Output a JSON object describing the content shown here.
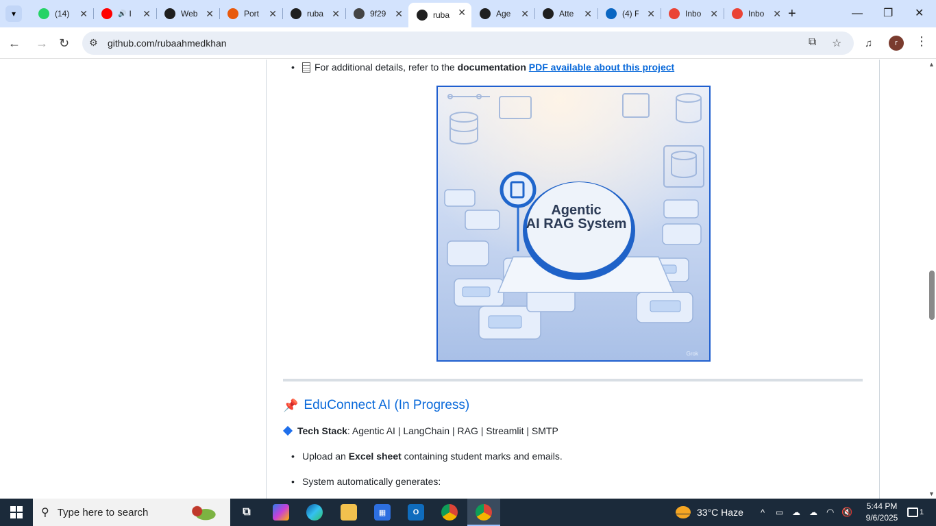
{
  "browser": {
    "tabs": [
      {
        "title": "(14)",
        "icon": "whatsapp-icon",
        "color": "#25d366"
      },
      {
        "title": "I",
        "icon": "youtube-icon",
        "color": "#ff0000",
        "audio": true
      },
      {
        "title": "Web",
        "icon": "openai-icon",
        "color": "#1f1f1f"
      },
      {
        "title": "Port",
        "icon": "portfolio-icon",
        "color": "#e8590c"
      },
      {
        "title": "ruba",
        "icon": "github-icon",
        "color": "#1f1f1f"
      },
      {
        "title": "9f29",
        "icon": "globe-icon",
        "color": "#444444"
      },
      {
        "title": "ruba",
        "icon": "github-icon",
        "color": "#1f1f1f",
        "active": true
      },
      {
        "title": "Age",
        "icon": "github-icon",
        "color": "#1f1f1f"
      },
      {
        "title": "Atte",
        "icon": "github-icon",
        "color": "#1f1f1f"
      },
      {
        "title": "(4) F",
        "icon": "linkedin-icon",
        "color": "#0a66c2"
      },
      {
        "title": "Inbo",
        "icon": "gmail-icon",
        "color": "#ea4335"
      },
      {
        "title": "Inbo",
        "icon": "gmail-icon",
        "color": "#ea4335"
      }
    ],
    "url": "github.com/rubaahmedkhan",
    "avatar_letter": "r"
  },
  "readme": {
    "doc_line": {
      "prefix": "For additional details, refer to the ",
      "bold": "documentation",
      "link": "PDF available about this project"
    },
    "image": {
      "title_line1": "Agentic",
      "title_line2": "AI RAG System",
      "watermark": "Grok"
    },
    "section_title": "EduConnect AI (In Progress)",
    "tech_stack": {
      "label": "Tech Stack",
      "value": ": Agentic AI | LangChain | RAG | Streamlit | SMTP"
    },
    "bullets": [
      {
        "pre": "Upload an ",
        "bold": "Excel sheet",
        "post": " containing student marks and emails."
      },
      {
        "pre": "System automatically generates:",
        "bold": "",
        "post": ""
      }
    ]
  },
  "taskbar": {
    "search_placeholder": "Type here to search",
    "weather": "33°C  Haze",
    "time": "5:44 PM",
    "date": "9/6/2025",
    "notification_count": "1"
  },
  "colors": {
    "tabstrip": "#d3e3fd",
    "link": "#0969da",
    "taskbar": "#1b2a3a"
  }
}
